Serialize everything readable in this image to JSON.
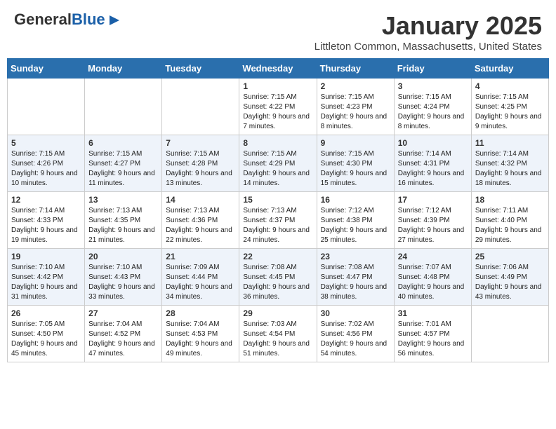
{
  "header": {
    "logo_general": "General",
    "logo_blue": "Blue",
    "month": "January 2025",
    "location": "Littleton Common, Massachusetts, United States"
  },
  "days_of_week": [
    "Sunday",
    "Monday",
    "Tuesday",
    "Wednesday",
    "Thursday",
    "Friday",
    "Saturday"
  ],
  "weeks": [
    [
      {
        "day": "",
        "info": ""
      },
      {
        "day": "",
        "info": ""
      },
      {
        "day": "",
        "info": ""
      },
      {
        "day": "1",
        "info": "Sunrise: 7:15 AM\nSunset: 4:22 PM\nDaylight: 9 hours and 7 minutes."
      },
      {
        "day": "2",
        "info": "Sunrise: 7:15 AM\nSunset: 4:23 PM\nDaylight: 9 hours and 8 minutes."
      },
      {
        "day": "3",
        "info": "Sunrise: 7:15 AM\nSunset: 4:24 PM\nDaylight: 9 hours and 8 minutes."
      },
      {
        "day": "4",
        "info": "Sunrise: 7:15 AM\nSunset: 4:25 PM\nDaylight: 9 hours and 9 minutes."
      }
    ],
    [
      {
        "day": "5",
        "info": "Sunrise: 7:15 AM\nSunset: 4:26 PM\nDaylight: 9 hours and 10 minutes."
      },
      {
        "day": "6",
        "info": "Sunrise: 7:15 AM\nSunset: 4:27 PM\nDaylight: 9 hours and 11 minutes."
      },
      {
        "day": "7",
        "info": "Sunrise: 7:15 AM\nSunset: 4:28 PM\nDaylight: 9 hours and 13 minutes."
      },
      {
        "day": "8",
        "info": "Sunrise: 7:15 AM\nSunset: 4:29 PM\nDaylight: 9 hours and 14 minutes."
      },
      {
        "day": "9",
        "info": "Sunrise: 7:15 AM\nSunset: 4:30 PM\nDaylight: 9 hours and 15 minutes."
      },
      {
        "day": "10",
        "info": "Sunrise: 7:14 AM\nSunset: 4:31 PM\nDaylight: 9 hours and 16 minutes."
      },
      {
        "day": "11",
        "info": "Sunrise: 7:14 AM\nSunset: 4:32 PM\nDaylight: 9 hours and 18 minutes."
      }
    ],
    [
      {
        "day": "12",
        "info": "Sunrise: 7:14 AM\nSunset: 4:33 PM\nDaylight: 9 hours and 19 minutes."
      },
      {
        "day": "13",
        "info": "Sunrise: 7:13 AM\nSunset: 4:35 PM\nDaylight: 9 hours and 21 minutes."
      },
      {
        "day": "14",
        "info": "Sunrise: 7:13 AM\nSunset: 4:36 PM\nDaylight: 9 hours and 22 minutes."
      },
      {
        "day": "15",
        "info": "Sunrise: 7:13 AM\nSunset: 4:37 PM\nDaylight: 9 hours and 24 minutes."
      },
      {
        "day": "16",
        "info": "Sunrise: 7:12 AM\nSunset: 4:38 PM\nDaylight: 9 hours and 25 minutes."
      },
      {
        "day": "17",
        "info": "Sunrise: 7:12 AM\nSunset: 4:39 PM\nDaylight: 9 hours and 27 minutes."
      },
      {
        "day": "18",
        "info": "Sunrise: 7:11 AM\nSunset: 4:40 PM\nDaylight: 9 hours and 29 minutes."
      }
    ],
    [
      {
        "day": "19",
        "info": "Sunrise: 7:10 AM\nSunset: 4:42 PM\nDaylight: 9 hours and 31 minutes."
      },
      {
        "day": "20",
        "info": "Sunrise: 7:10 AM\nSunset: 4:43 PM\nDaylight: 9 hours and 33 minutes."
      },
      {
        "day": "21",
        "info": "Sunrise: 7:09 AM\nSunset: 4:44 PM\nDaylight: 9 hours and 34 minutes."
      },
      {
        "day": "22",
        "info": "Sunrise: 7:08 AM\nSunset: 4:45 PM\nDaylight: 9 hours and 36 minutes."
      },
      {
        "day": "23",
        "info": "Sunrise: 7:08 AM\nSunset: 4:47 PM\nDaylight: 9 hours and 38 minutes."
      },
      {
        "day": "24",
        "info": "Sunrise: 7:07 AM\nSunset: 4:48 PM\nDaylight: 9 hours and 40 minutes."
      },
      {
        "day": "25",
        "info": "Sunrise: 7:06 AM\nSunset: 4:49 PM\nDaylight: 9 hours and 43 minutes."
      }
    ],
    [
      {
        "day": "26",
        "info": "Sunrise: 7:05 AM\nSunset: 4:50 PM\nDaylight: 9 hours and 45 minutes."
      },
      {
        "day": "27",
        "info": "Sunrise: 7:04 AM\nSunset: 4:52 PM\nDaylight: 9 hours and 47 minutes."
      },
      {
        "day": "28",
        "info": "Sunrise: 7:04 AM\nSunset: 4:53 PM\nDaylight: 9 hours and 49 minutes."
      },
      {
        "day": "29",
        "info": "Sunrise: 7:03 AM\nSunset: 4:54 PM\nDaylight: 9 hours and 51 minutes."
      },
      {
        "day": "30",
        "info": "Sunrise: 7:02 AM\nSunset: 4:56 PM\nDaylight: 9 hours and 54 minutes."
      },
      {
        "day": "31",
        "info": "Sunrise: 7:01 AM\nSunset: 4:57 PM\nDaylight: 9 hours and 56 minutes."
      },
      {
        "day": "",
        "info": ""
      }
    ]
  ]
}
